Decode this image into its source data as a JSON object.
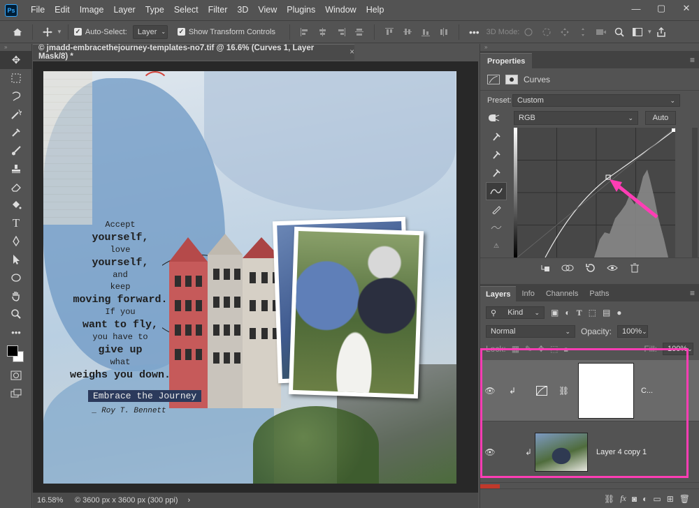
{
  "app": {
    "logo": "Ps"
  },
  "menu": [
    "File",
    "Edit",
    "Image",
    "Layer",
    "Type",
    "Select",
    "Filter",
    "3D",
    "View",
    "Plugins",
    "Window",
    "Help"
  ],
  "window_controls": {
    "minimize": "—",
    "maximize": "▢",
    "close": "✕"
  },
  "options_bar": {
    "auto_select_label": "Auto-Select:",
    "auto_select_target": "Layer",
    "show_transform_label": "Show Transform Controls",
    "mode_label": "3D Mode:"
  },
  "document": {
    "tab_title": "© jmadd-embracethejourney-templates-no7.tif @ 16.6% (Curves 1, Layer Mask/8) *",
    "tab_close": "×",
    "canvas_quote": {
      "l1": "Accept",
      "l2": "yourself,",
      "l3": "love",
      "l4": "yourself,",
      "l5": "and",
      "l6": "keep",
      "l7": "moving forward.",
      "l8": "If you",
      "l9": "want to fly,",
      "l10": "you have to",
      "l11": "give up",
      "l12": "what",
      "l13": "weighs you down."
    },
    "canvas_title": "Embrace the Journey",
    "canvas_author": "_ Roy T. Bennett"
  },
  "status": {
    "zoom": "16.58%",
    "dimensions": "© 3600 px x 3600 px (300 ppi)",
    "arrow": "›"
  },
  "properties": {
    "title": "Properties",
    "adjustment_name": "Curves",
    "preset_label": "Preset:",
    "preset_value": "Custom",
    "channel": "RGB",
    "auto_button": "Auto"
  },
  "layers_panel": {
    "tabs": [
      "Layers",
      "Info",
      "Channels",
      "Paths"
    ],
    "kind_label": "Kind",
    "blend_mode": "Normal",
    "opacity_label": "Opacity:",
    "opacity_value": "100%",
    "lock_label": "Lock:",
    "fill_label": "Fill:",
    "fill_value": "100%",
    "layers": [
      {
        "name": "C..."
      },
      {
        "name": "Layer 4 copy 1"
      }
    ]
  },
  "colors": {
    "accent_highlight": "#ff3db5",
    "arrow": "#ff3db5",
    "ps_blue": "#31a8ff"
  }
}
